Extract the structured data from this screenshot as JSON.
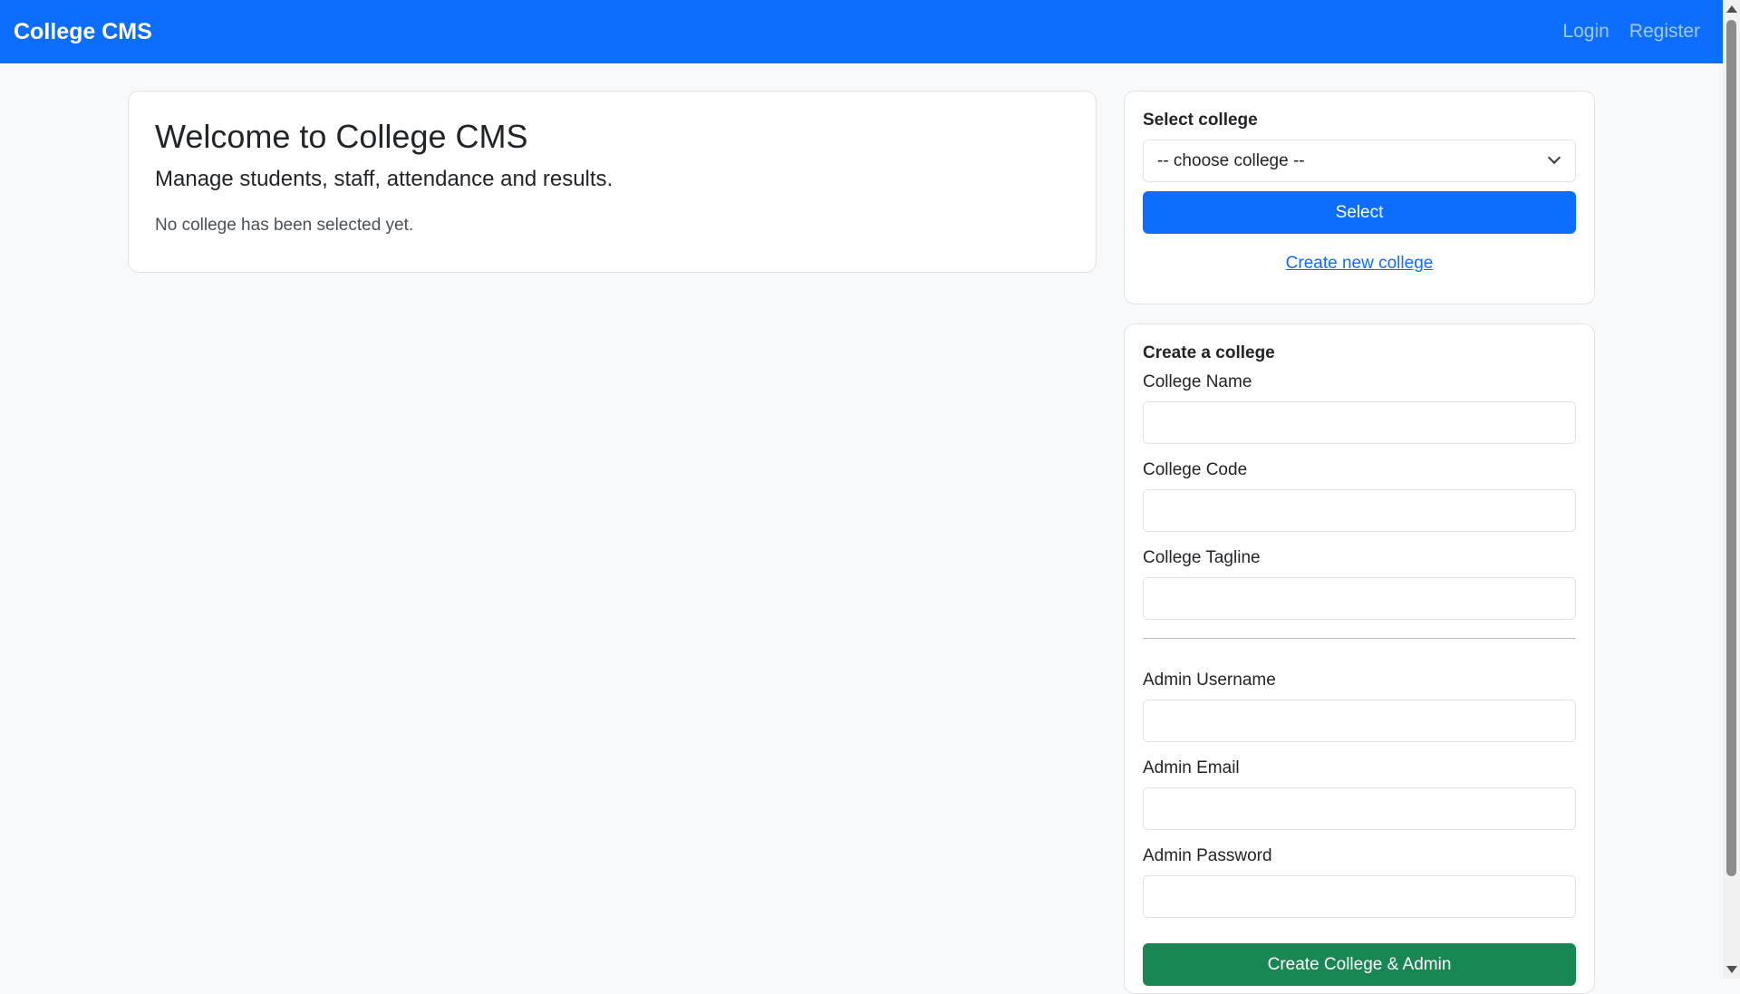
{
  "navbar": {
    "brand": "College CMS",
    "links": [
      "Login",
      "Register"
    ]
  },
  "welcome": {
    "title": "Welcome to College CMS",
    "lead": "Manage students, staff, attendance and results.",
    "status": "No college has been selected yet."
  },
  "select_college": {
    "heading": "Select college",
    "selected_value": "-- choose college --",
    "button_label": "Select",
    "create_link": "Create new college"
  },
  "create_college": {
    "heading": "Create a college",
    "fields": {
      "college_name": "College Name",
      "college_code": "College Code",
      "college_tagline": "College Tagline",
      "admin_username": "Admin Username",
      "admin_email": "Admin Email",
      "admin_password": "Admin Password"
    },
    "submit_label": "Create College & Admin"
  },
  "colors": {
    "primary": "#0d6efd",
    "success": "#198754",
    "background": "#f8f9fa"
  }
}
